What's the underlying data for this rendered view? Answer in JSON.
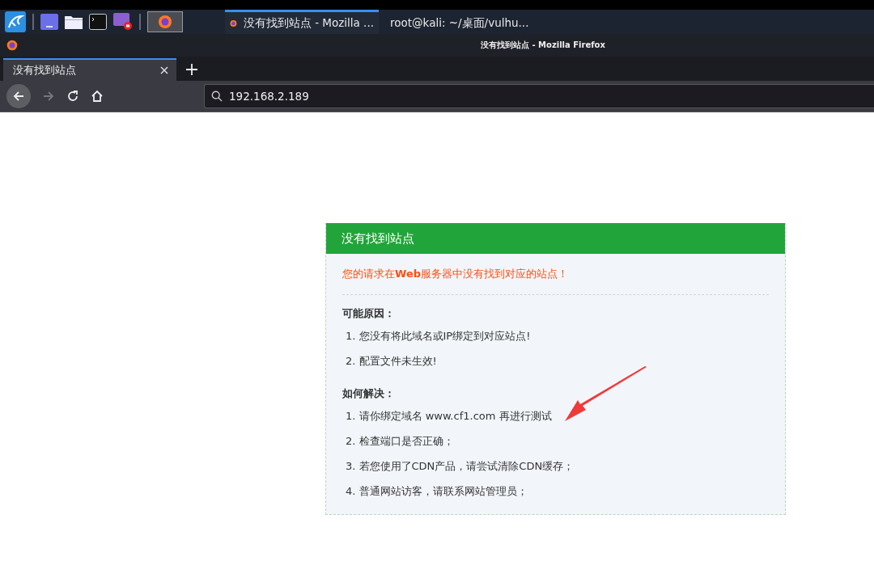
{
  "taskbar": {
    "window_buttons": [
      {
        "kind": "firefox",
        "title": "没有找到站点 - Mozilla ...",
        "selected": true
      },
      {
        "kind": "terminal",
        "title": "root@kali: ~/桌面/vulhu...",
        "selected": false
      }
    ]
  },
  "window": {
    "title": "没有找到站点 - Mozilla Firefox"
  },
  "tabs": [
    {
      "label": "没有找到站点",
      "selected": true
    }
  ],
  "address_bar": {
    "value": "192.168.2.189"
  },
  "page": {
    "heading": "没有找到站点",
    "error": "您的请求在**Web**服务器中没有找到对应的站点！",
    "reasons_title": "可能原因：",
    "reasons": [
      "1. 您没有将此域名或IP绑定到对应站点!",
      "2. 配置文件未生效!"
    ],
    "solutions_title": "如何解决：",
    "solutions": [
      "1. 请你绑定域名 www.cf1.com 再进行测试",
      "2. 检查端口是否正确；",
      "3. 若您使用了CDN产品，请尝试清除CDN缓存；",
      "4. 普通网站访客，请联系网站管理员；"
    ]
  }
}
